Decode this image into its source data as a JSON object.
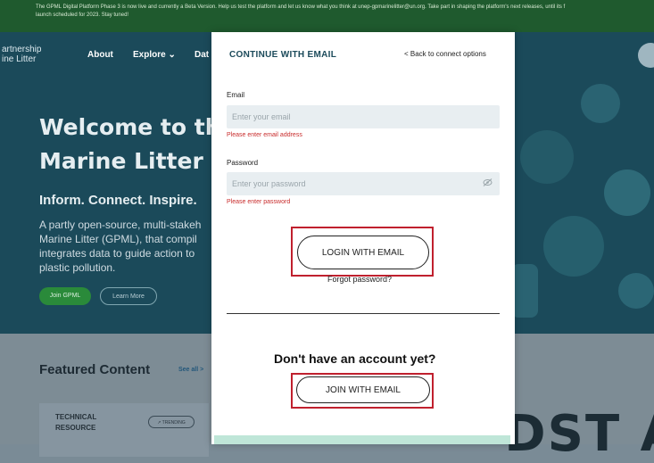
{
  "banner": {
    "line1": "The GPML Digital Platform Phase 3 is now live and currently a Beta Version. Help us test the platform and let us know what you think at unep-gpmarinelitter@un.org. Take part in shaping the platform's next releases, until its f",
    "line2": "launch scheduled for 2023. Stay tuned!"
  },
  "nav": {
    "logo_line1": "artnership",
    "logo_line2": "ine Litter",
    "about": "About",
    "explore": "Explore ⌄",
    "data": "Dat"
  },
  "hero": {
    "title_line1": "Welcome to th",
    "title_line2": "Marine Litter a",
    "subtitle": "Inform. Connect. Inspire.",
    "body_lines": [
      "A partly open-source, multi-stakeh",
      "Marine Litter (GPML), that compil",
      "integrates data to guide action to",
      "plastic pollution."
    ],
    "join_label": "Join GPML",
    "learn_label": "Learn More"
  },
  "featured": {
    "title": "Featured Content",
    "see_all": "See all >",
    "card_label_line1": "TECHNICAL",
    "card_label_line2": "RESOURCE",
    "trending": "↗ TRENDING"
  },
  "modal": {
    "title": "CONTINUE WITH EMAIL",
    "back": "< Back to connect options",
    "email_label": "Email",
    "email_placeholder": "Enter your email",
    "email_error": "Please enter email address",
    "password_label": "Password",
    "password_placeholder": "Enter your password",
    "password_error": "Please enter password",
    "login_button": "LOGIN WITH EMAIL",
    "forgot": "Forgot password?",
    "no_account": "Don't have an account yet?",
    "join_button": "JOIN WITH EMAIL"
  },
  "colors": {
    "banner_bg": "#1f5a2e",
    "hero_bg": "#1b4a5a",
    "error": "#c82b2b",
    "highlight": "#c0202e"
  },
  "icons": {
    "eye": "eye-slash-icon"
  }
}
